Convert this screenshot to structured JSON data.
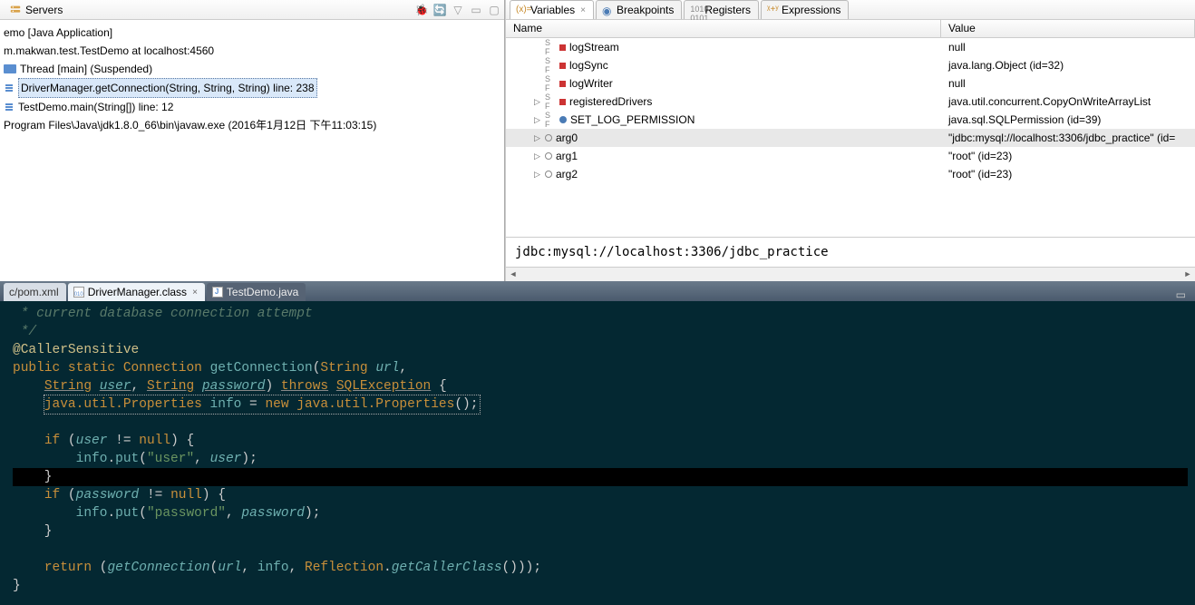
{
  "servers_pane": {
    "title": "Servers",
    "lines": [
      "emo [Java Application]",
      "m.makwan.test.TestDemo at localhost:4560",
      "Thread [main] (Suspended)",
      "DriverManager.getConnection(String, String, String) line: 238",
      "TestDemo.main(String[]) line: 12",
      "Program Files\\Java\\jdk1.8.0_66\\bin\\javaw.exe (2016年1月12日 下午11:03:15)"
    ]
  },
  "right_tabs": [
    {
      "label": "Variables",
      "active": true
    },
    {
      "label": "Breakpoints",
      "active": false
    },
    {
      "label": "Registers",
      "active": false
    },
    {
      "label": "Expressions",
      "active": false
    }
  ],
  "vars_header": {
    "name": "Name",
    "value": "Value"
  },
  "variables": [
    {
      "icon": "sf-red",
      "name": "logStream",
      "value": "null",
      "exp": false
    },
    {
      "icon": "sf-red",
      "name": "logSync",
      "value": "java.lang.Object  (id=32)",
      "exp": false
    },
    {
      "icon": "sf-red",
      "name": "logWriter",
      "value": "null",
      "exp": false
    },
    {
      "icon": "sf-red",
      "name": "registeredDrivers",
      "value": "java.util.concurrent.CopyOnWriteArrayList<E>",
      "exp": true
    },
    {
      "icon": "sf-blue",
      "name": "SET_LOG_PERMISSION",
      "value": "java.sql.SQLPermission  (id=39)",
      "exp": true
    },
    {
      "icon": "circle",
      "name": "arg0",
      "value": "\"jdbc:mysql://localhost:3306/jdbc_practice\" (id=",
      "exp": true,
      "sel": true
    },
    {
      "icon": "circle",
      "name": "arg1",
      "value": "\"root\" (id=23)",
      "exp": true
    },
    {
      "icon": "circle",
      "name": "arg2",
      "value": "\"root\" (id=23)",
      "exp": true
    }
  ],
  "detail_value": "jdbc:mysql://localhost:3306/jdbc_practice",
  "editor_tabs": [
    {
      "label": "c/pom.xml",
      "type": "plain",
      "active": false
    },
    {
      "label": "DriverManager.class",
      "type": "class",
      "active": true
    },
    {
      "label": "TestDemo.java",
      "type": "java",
      "active": false
    }
  ],
  "code": {
    "l1": " * current database connection attempt",
    "l2": " */",
    "l3": "@CallerSensitive",
    "l4a": "public",
    "l4b": "static",
    "l4c": "Connection",
    "l4d": "getConnection",
    "l4e": "String",
    "l4f": "url",
    "l5a": "String",
    "l5b": "user",
    "l5c": "String",
    "l5d": "password",
    "l5e": "throws",
    "l5f": "SQLException",
    "l6a": "java.util.Properties",
    "l6b": "info",
    "l6c": "new",
    "l6d": "java.util.Properties",
    "l8a": "if",
    "l8b": "user",
    "l8c": "null",
    "l9a": "info",
    "l9b": "put",
    "l9c": "\"user\"",
    "l9d": "user",
    "l11a": "if",
    "l11b": "password",
    "l11c": "null",
    "l12a": "info",
    "l12b": "put",
    "l12c": "\"password\"",
    "l12d": "password",
    "l14a": "return",
    "l14b": "getConnection",
    "l14c": "url",
    "l14d": "info",
    "l14e": "Reflection",
    "l14f": "getCallerClass"
  }
}
